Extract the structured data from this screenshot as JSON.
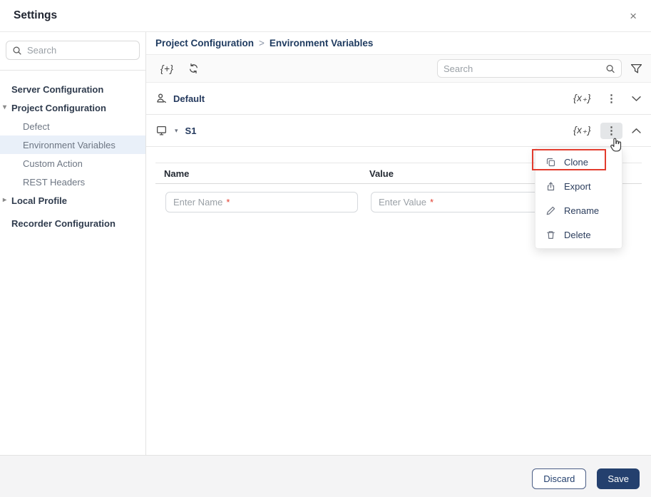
{
  "dialog": {
    "title": "Settings",
    "close_glyph": "×"
  },
  "sidebar": {
    "search_placeholder": "Search",
    "items": [
      {
        "label": "Server Configuration"
      },
      {
        "label": "Project Configuration",
        "expanded": true
      },
      {
        "label": "Defect"
      },
      {
        "label": "Environment Variables",
        "selected": true
      },
      {
        "label": "Custom Action"
      },
      {
        "label": "REST Headers"
      },
      {
        "label": "Local Profile",
        "collapsed": true
      },
      {
        "label": "Recorder Configuration"
      }
    ],
    "caret_down": "▾",
    "caret_right": "▸"
  },
  "breadcrumb": {
    "items": [
      "Project Configuration",
      "Environment Variables"
    ],
    "separator": ">"
  },
  "toolbar": {
    "add_variable_glyph": "{+}",
    "search_placeholder": "Search"
  },
  "sections": [
    {
      "name": "Default",
      "variables_glyph": "{x₊}",
      "state": "collapsed"
    },
    {
      "name": "S1",
      "variables_glyph": "{x₊}",
      "state": "expanded",
      "caret": "▾"
    }
  ],
  "kebab_glyph": "⋮",
  "table": {
    "columns": [
      "Name",
      "Value"
    ],
    "name_placeholder": "Enter Name",
    "value_placeholder": "Enter Value",
    "required_mark": "*"
  },
  "context_menu": {
    "items": [
      {
        "label": "Clone",
        "highlighted": true
      },
      {
        "label": "Export"
      },
      {
        "label": "Rename"
      },
      {
        "label": "Delete"
      }
    ]
  },
  "footer": {
    "discard_label": "Discard",
    "save_label": "Save"
  },
  "colors": {
    "accent_navy": "#24406e",
    "breadcrumb_text": "#1e3a5f",
    "highlight_red": "#e23c2e",
    "selected_item_bg": "#e9f0f9",
    "kebab_active_bg": "#e4e6e8"
  }
}
